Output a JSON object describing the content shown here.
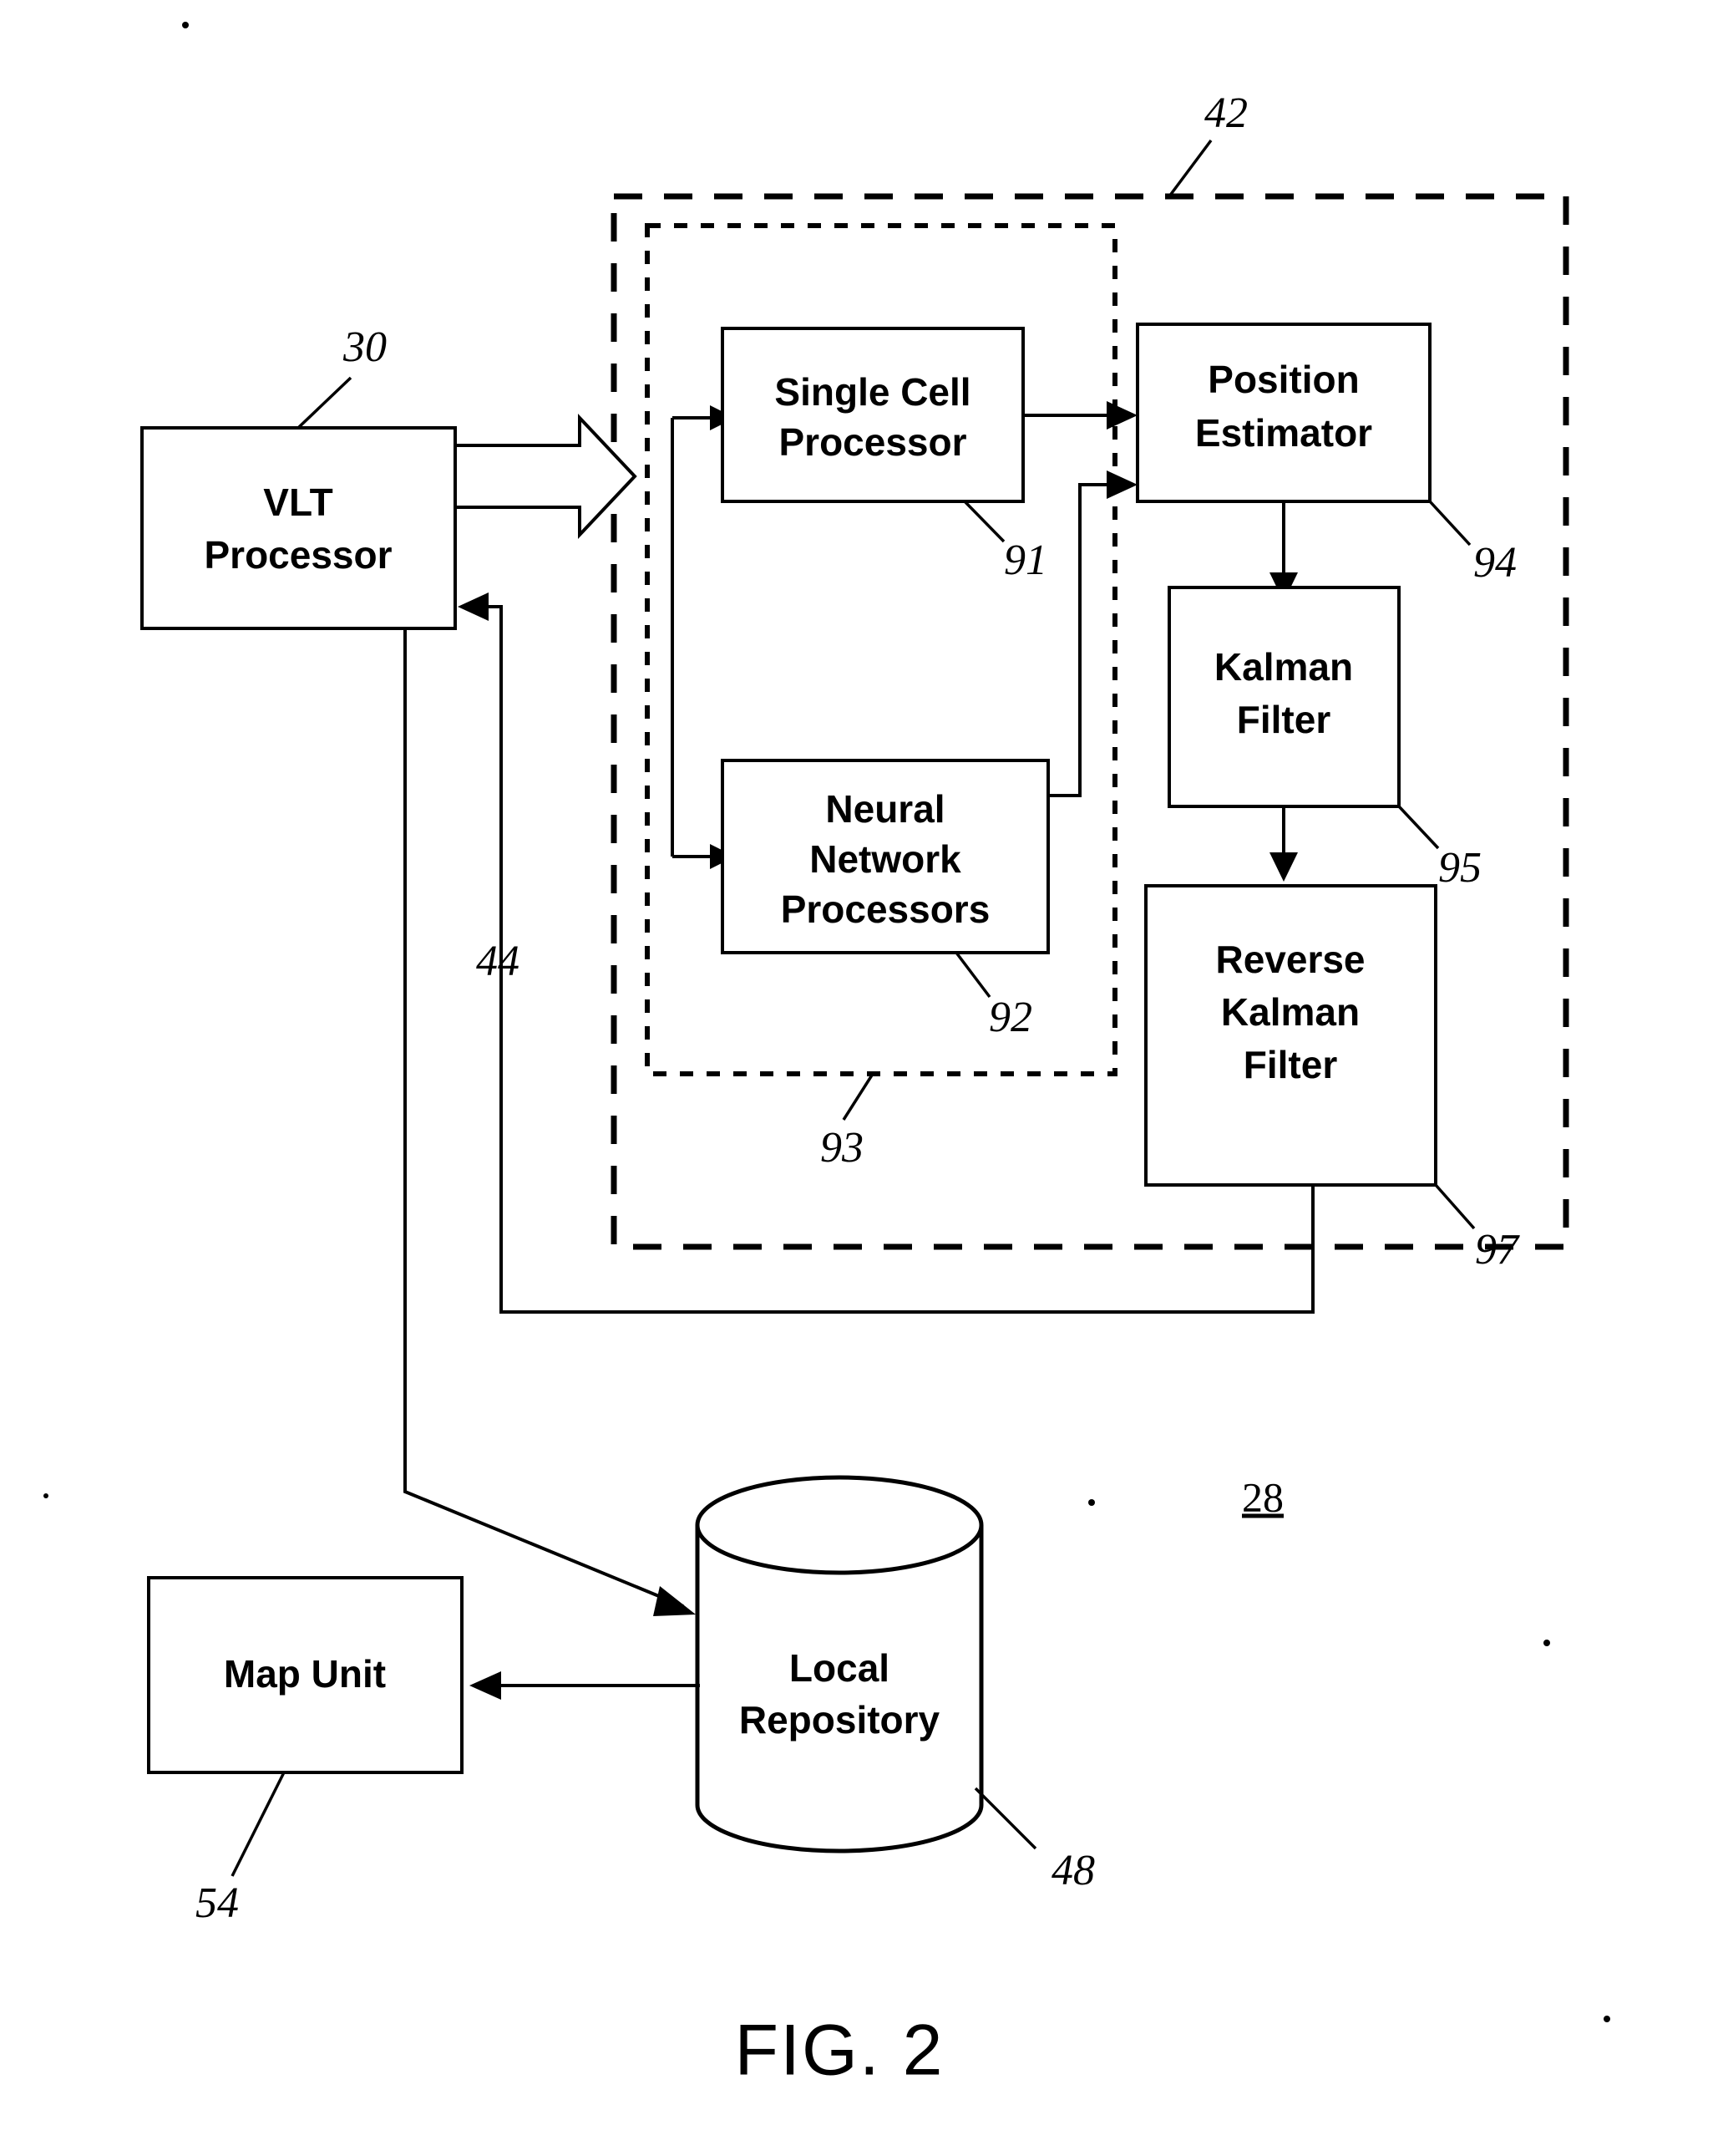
{
  "figure": {
    "caption": "FIG. 2",
    "system_reference": "28"
  },
  "nodes": [
    {
      "id": "vlt_processor",
      "label_line1": "VLT",
      "label_line2": "Processor",
      "label_line3": "",
      "ref": "30"
    },
    {
      "id": "single_cell",
      "label_line1": "Single Cell",
      "label_line2": "Processor",
      "label_line3": "",
      "ref": "91"
    },
    {
      "id": "neural_network",
      "label_line1": "Neural",
      "label_line2": "Network",
      "label_line3": "Processors",
      "ref": "92"
    },
    {
      "id": "position_estimator",
      "label_line1": "Position",
      "label_line2": "Estimator",
      "label_line3": "",
      "ref": "94"
    },
    {
      "id": "kalman_filter",
      "label_line1": "Kalman",
      "label_line2": "Filter",
      "label_line3": "",
      "ref": "95"
    },
    {
      "id": "reverse_kalman",
      "label_line1": "Reverse",
      "label_line2": "Kalman",
      "label_line3": "Filter",
      "ref": "97"
    },
    {
      "id": "map_unit",
      "label_line1": "Map Unit",
      "label_line2": "",
      "label_line3": "",
      "ref": "54"
    },
    {
      "id": "local_repository",
      "label_line1": "Local",
      "label_line2": "Repository",
      "label_line3": "",
      "ref": "48"
    }
  ],
  "groups": [
    {
      "id": "outer_group",
      "ref": "42"
    },
    {
      "id": "inner_group",
      "ref": "93"
    }
  ],
  "connections": [
    {
      "id": "feedback_bus",
      "ref": "44"
    }
  ],
  "labels": {
    "ref_30": "30",
    "ref_42": "42",
    "ref_44": "44",
    "ref_48": "48",
    "ref_54": "54",
    "ref_91": "91",
    "ref_92": "92",
    "ref_93": "93",
    "ref_94": "94",
    "ref_95": "95",
    "ref_97": "97",
    "ref_28": "28"
  },
  "text": {
    "vlt_l1": "VLT",
    "vlt_l2": "Processor",
    "scp_l1": "Single Cell",
    "scp_l2": "Processor",
    "nnp_l1": "Neural",
    "nnp_l2": "Network",
    "nnp_l3": "Processors",
    "pe_l1": "Position",
    "pe_l2": "Estimator",
    "kf_l1": "Kalman",
    "kf_l2": "Filter",
    "rkf_l1": "Reverse",
    "rkf_l2": "Kalman",
    "rkf_l3": "Filter",
    "map_l1": "Map Unit",
    "repo_l1": "Local",
    "repo_l2": "Repository",
    "fig": "FIG. 2"
  },
  "colors": {
    "ink": "#000000",
    "paper": "#ffffff"
  }
}
